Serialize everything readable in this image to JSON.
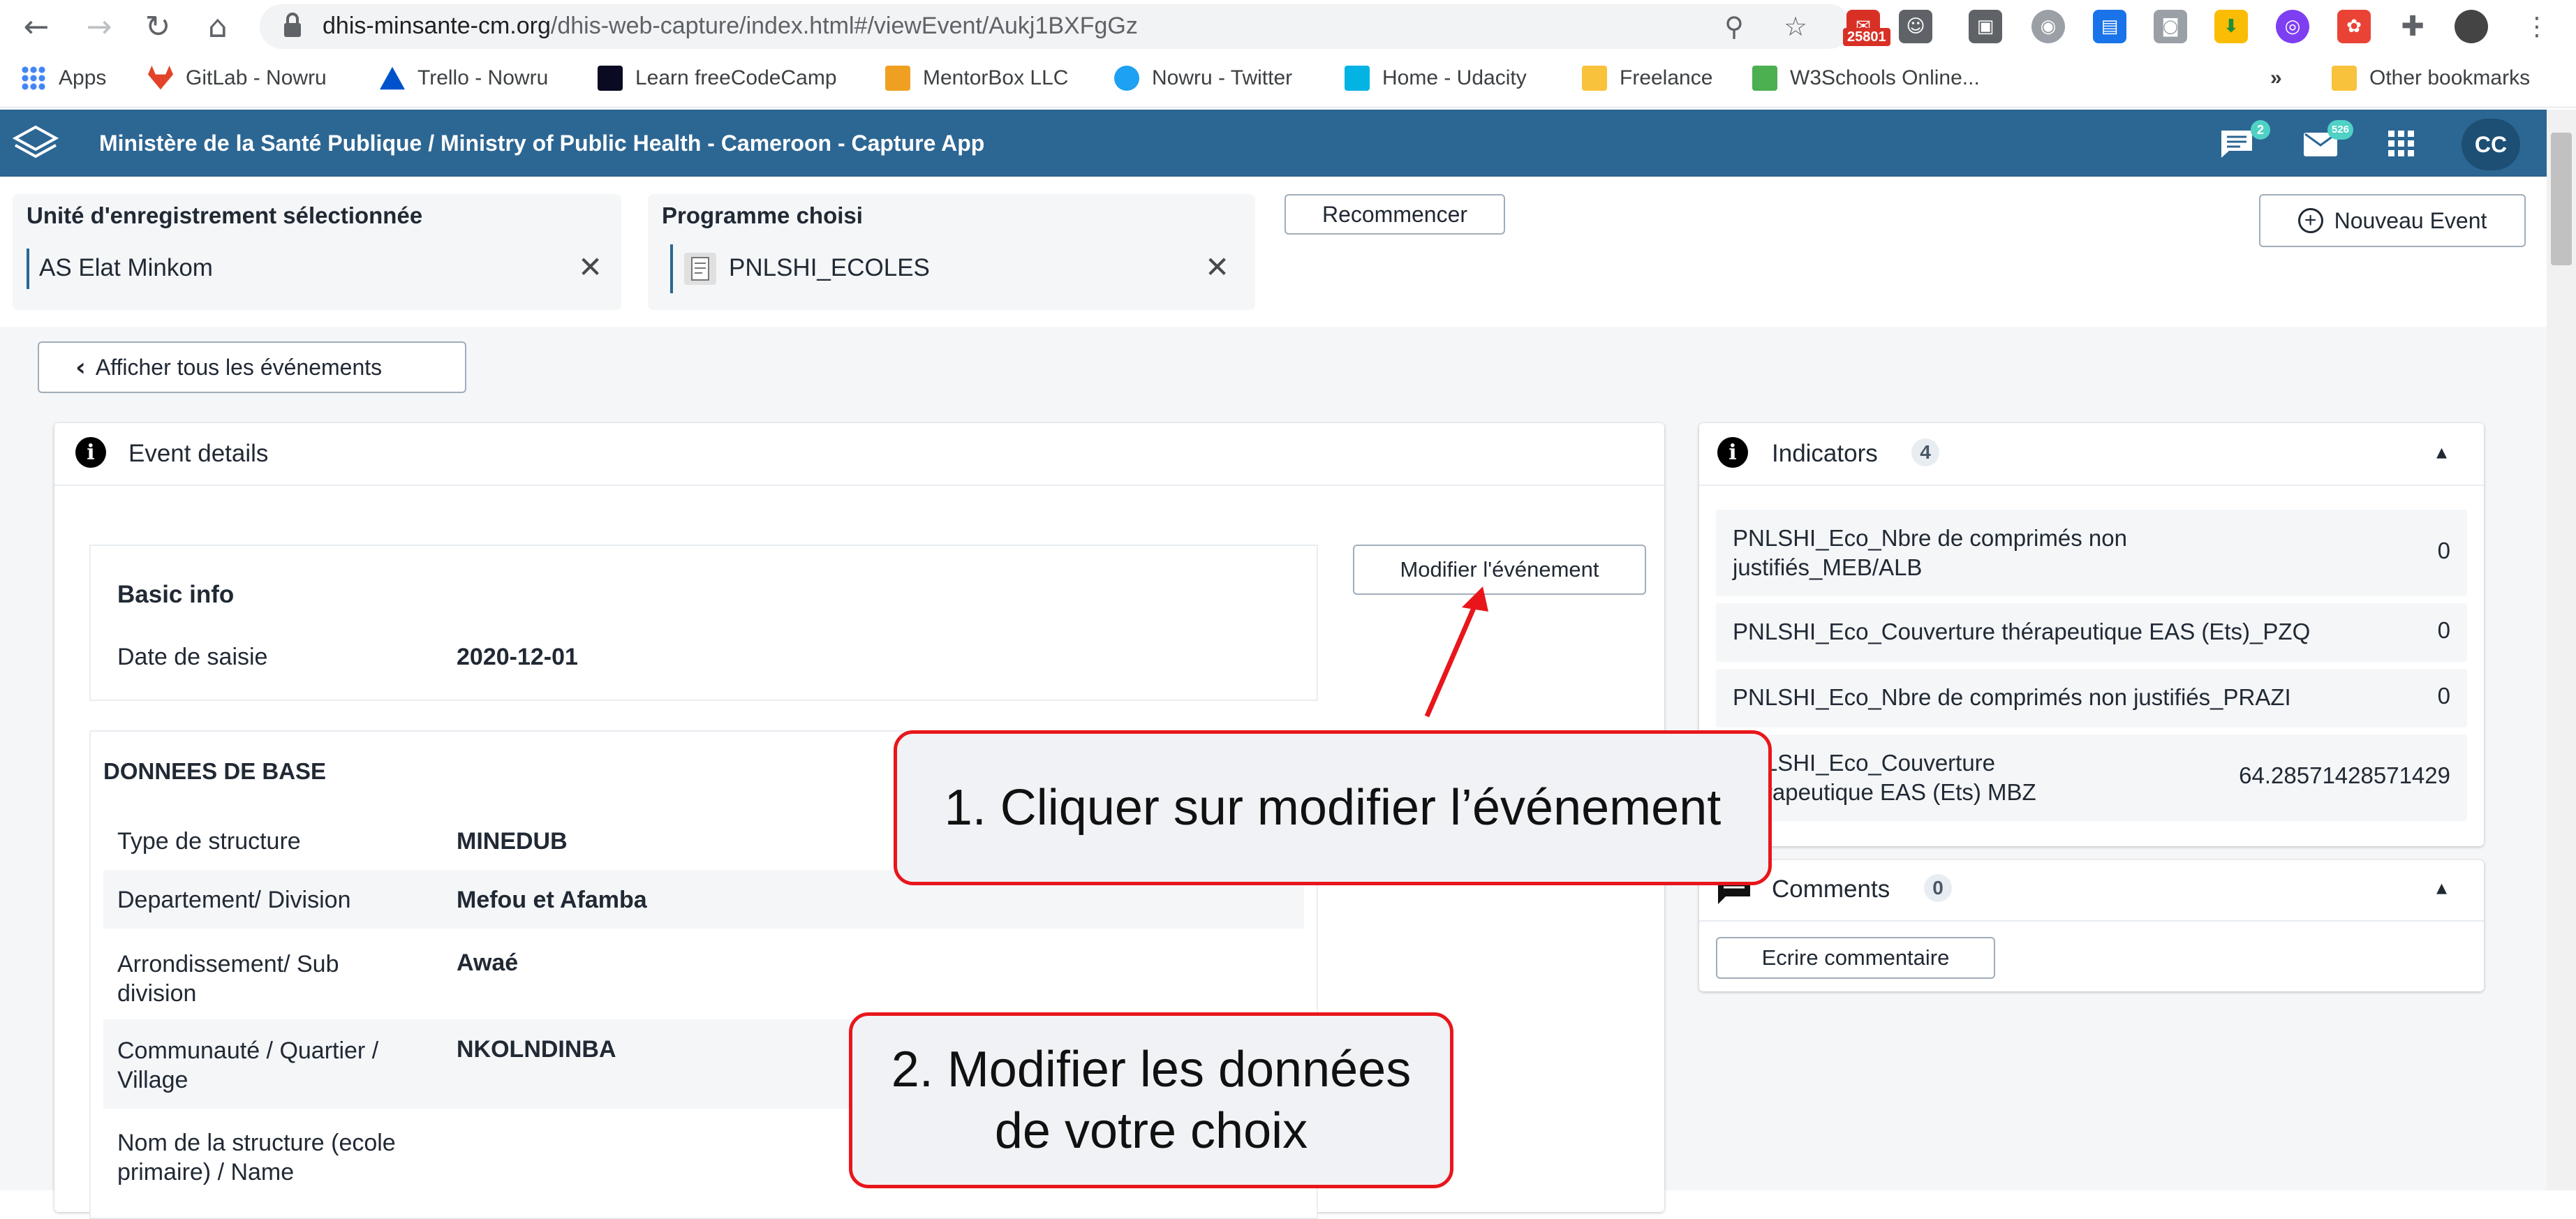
{
  "browser": {
    "url_domain": "dhis-minsante-cm.org",
    "url_path": "/dhis-web-capture/index.html#/viewEvent/Aukj1BXFgGz",
    "ext_badge": "25801",
    "bookmarks": [
      {
        "label": "Apps",
        "color": "#4285f4"
      },
      {
        "label": "GitLab - Nowru",
        "color": "#e24329"
      },
      {
        "label": "Trello - Nowru",
        "color": "#0079bf"
      },
      {
        "label": "Learn freeCodeCamp",
        "color": "#0a0a23"
      },
      {
        "label": "MentorBox LLC",
        "color": "#f0a020"
      },
      {
        "label": "Nowru - Twitter",
        "color": "#1da1f2"
      },
      {
        "label": "Home - Udacity",
        "color": "#02b3e4"
      },
      {
        "label": "Freelance",
        "color": "#f9c23c"
      },
      {
        "label": "W3Schools Online...",
        "color": "#4caf50"
      }
    ],
    "bookmarks_more": "»",
    "other_bookmarks": "Other bookmarks"
  },
  "app": {
    "title": "Ministère de la Santé Publique / Ministry of Public Health - Cameroon - Capture App",
    "messages_count": "2",
    "mail_count": "526",
    "avatar_initials": "CC",
    "header_color": "#2c6693"
  },
  "selection": {
    "org_unit_label": "Unité d'enregistrement sélectionnée",
    "org_unit_value": "AS Elat Minkom",
    "program_label": "Programme choisi",
    "program_value": "PNLSHI_ECOLES",
    "restart_button": "Recommencer",
    "new_event_button": "Nouveau Event"
  },
  "page": {
    "back_button": "Afficher tous les événements",
    "event_details_title": "Event details",
    "edit_button": "Modifier l'événement",
    "basic_info": {
      "title": "Basic info",
      "rows": [
        {
          "label": "Date de saisie",
          "value": "2020-12-01"
        }
      ]
    },
    "section": {
      "title": "DONNEES DE BASE",
      "rows": [
        {
          "label": "Type de structure",
          "value": "MINEDUB"
        },
        {
          "label": "Departement/ Division",
          "value": "Mefou et Afamba"
        },
        {
          "label": "Arrondissement/ Sub division",
          "value": "Awaé"
        },
        {
          "label": "Communauté / Quartier / Village",
          "value": "NKOLNDINBA"
        },
        {
          "label": "Nom de la structure (ecole primaire) / Name",
          "value": ""
        }
      ]
    },
    "indicators": {
      "title": "Indicators",
      "count": "4",
      "items": [
        {
          "label": "PNLSHI_Eco_Nbre de comprimés non justifiés_MEB/ALB",
          "value": "0"
        },
        {
          "label": "PNLSHI_Eco_Couverture thérapeutique EAS (Ets)_PZQ",
          "value": "0"
        },
        {
          "label": "PNLSHI_Eco_Nbre de comprimés non justifiés_PRAZI",
          "value": "0"
        },
        {
          "label": "PNLSHI_Eco_Couverture thérapeutique EAS (Ets) MBZ",
          "value": "64.28571428571429"
        }
      ]
    },
    "comments": {
      "title": "Comments",
      "count": "0",
      "write_button": "Ecrire commentaire"
    }
  },
  "annotations": {
    "step1": "1. Cliquer sur modifier l’événement",
    "step2": "2. Modifier les données de votre choix",
    "arrow_color": "#e8161b"
  }
}
